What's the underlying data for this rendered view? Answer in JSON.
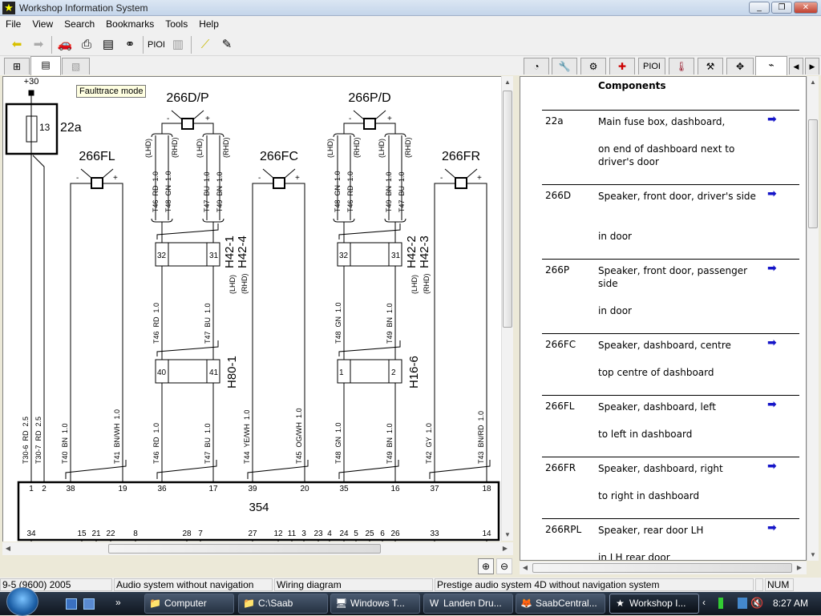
{
  "window": {
    "title": "Workshop Information System",
    "controls": [
      "minimize",
      "maximize",
      "close"
    ]
  },
  "menu": [
    "File",
    "View",
    "Search",
    "Bookmarks",
    "Tools",
    "Help"
  ],
  "toolbar": {
    "icons": [
      "back-arrow-icon",
      "forward-arrow-icon",
      "car-icon",
      "print-icon",
      "download-doc-icon",
      "binoculars-icon",
      "pioi-icon",
      "tech2-icon",
      "ruler-icon",
      "note-icon"
    ],
    "pioi_label": "PIOI"
  },
  "left_tabs": [
    "tree-icon",
    "document-icon",
    "diagram-icon"
  ],
  "right_tabs": {
    "icons": [
      "gauge-icon",
      "wrench-icon",
      "gears-icon",
      "first-aid-icon",
      "pioi-icon",
      "thermometer-icon",
      "tools-icon",
      "move-icon",
      "wiring-icon"
    ],
    "pioi_label": "PIOI"
  },
  "tooltip": "Faulttrace mode",
  "diagram": {
    "supply": "+30",
    "fuse": {
      "id": "22a",
      "number": "13"
    },
    "speakers": {
      "fl": "266FL",
      "fc": "266FC",
      "fr": "266FR",
      "dp": "266D/P",
      "pd": "266P/D"
    },
    "polarity": {
      "minus": "-",
      "plus": "+"
    },
    "lhd": "(LHD)",
    "rhd": "(RHD)",
    "dp_wires": [
      "T46  RD  1.0",
      "T48  GN  1.0",
      "T47  BU  1.0",
      "T49  BN  1.0"
    ],
    "pd_wires": [
      "T48  GN  1.0",
      "T46  RD  1.0",
      "T49  BN  1.0",
      "T47  BU  1.0"
    ],
    "left_connectors": {
      "h42a": "H42-1",
      "h42b": "H42-4",
      "h42_pins": [
        "32",
        "31"
      ],
      "mid_wires": [
        "T46  RD  1.0",
        "T47  BU  1.0"
      ],
      "h80": "H80-1",
      "h80_pins": [
        "40",
        "41"
      ]
    },
    "right_connectors": {
      "h42a": "H42-2",
      "h42b": "H42-3",
      "h42_pins": [
        "32",
        "31"
      ],
      "mid_wires": [
        "T48  GN  1.0",
        "T49  BN  1.0"
      ],
      "h16": "H16-6",
      "h16_pins": [
        "1",
        "2"
      ]
    },
    "bottom_wires": [
      "T30-6  RD  2.5",
      "T30-7  RD  2.5",
      "T40  BN  1.0",
      "T41  BN/WH  1.0",
      "T46  RD  1.0",
      "T47  BU  1.0",
      "T44  YE/WH  1.0",
      "T45  OG/WH  1.0",
      "T48  GN  1.0",
      "T49  BN  1.0",
      "T42  GY  1.0",
      "T43  BN/RD  1.0"
    ],
    "unit": {
      "id": "354",
      "top_pins": [
        "1",
        "2",
        "38",
        "19",
        "36",
        "17",
        "39",
        "20",
        "35",
        "16",
        "37",
        "18"
      ],
      "bottom_pins": [
        "34",
        "15",
        "21",
        "22",
        "8",
        "28",
        "7",
        "27",
        "12",
        "11",
        "3",
        "23",
        "4",
        "24",
        "5",
        "25",
        "6",
        "26",
        "33",
        "14"
      ]
    }
  },
  "components": {
    "title": "Components",
    "rows": [
      {
        "id": "22a",
        "name": "Main fuse box, dashboard,",
        "location": "on end of dashboard next to driver's door"
      },
      {
        "id": "266D",
        "name": "Speaker, front door, driver's side",
        "location": "in door"
      },
      {
        "id": "266P",
        "name": "Speaker, front door, passenger side",
        "location": "in door"
      },
      {
        "id": "266FC",
        "name": "Speaker, dashboard, centre",
        "location": "top centre of dashboard"
      },
      {
        "id": "266FL",
        "name": "Speaker, dashboard, left",
        "location": "to left in dashboard"
      },
      {
        "id": "266FR",
        "name": "Speaker, dashboard, right",
        "location": "to right in dashboard"
      },
      {
        "id": "266RPL",
        "name": "Speaker, rear door LH",
        "location": "in LH rear door"
      }
    ],
    "link_icon": "arrow-right-icon"
  },
  "status": [
    "9-5 (9600) 2005",
    "Audio system without navigation",
    "Wiring diagram",
    "Prestige audio system 4D without navigation system",
    "",
    "NUM"
  ],
  "taskbar": {
    "items": [
      "Computer",
      "C:\\Saab",
      "Windows T...",
      "Landen Dru...",
      "SaabCentral...",
      "Workshop I..."
    ],
    "active": "Workshop I...",
    "clock": "8:27 AM"
  },
  "colors": {
    "link_arrow": "#1515c8",
    "tooltip_bg": "#ffffe1"
  }
}
